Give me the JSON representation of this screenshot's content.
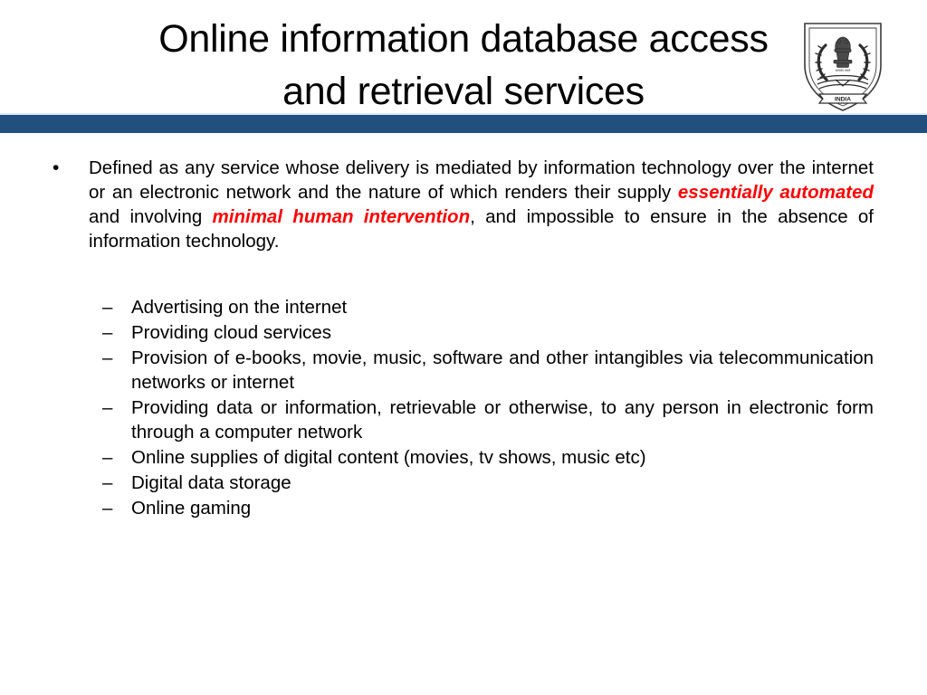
{
  "slide": {
    "background_color": "#ffffff",
    "accent_bar_color": "#21507f",
    "accent_bar_hairline_color": "#dce9f2",
    "highlight_color": "#ff0000",
    "text_color": "#000000"
  },
  "title": {
    "line1": "Online information database access",
    "line2": "and retrieval services",
    "full": "Online information database access and retrieval services"
  },
  "emblem": {
    "name": "india-shield-emblem",
    "banner_text": "INDIA",
    "motto_text": "सत्यमेव जयते"
  },
  "content": {
    "main_bullet": {
      "marker": "•",
      "segments": [
        {
          "text": "Defined as any service whose delivery is mediated by information technology over the internet or an electronic network and the nature of which renders their supply ",
          "style": "normal"
        },
        {
          "text": "essentially automated",
          "style": "highlight"
        },
        {
          "text": " and involving ",
          "style": "normal"
        },
        {
          "text": "minimal human intervention",
          "style": "highlight"
        },
        {
          "text": ", and impossible to ensure in the absence of information technology.",
          "style": "normal"
        }
      ],
      "plain_text": "Defined as any service whose delivery is mediated by information technology over the internet or an electronic network and the nature of which renders their supply essentially automated and involving minimal human intervention, and impossible to ensure in the absence of information technology."
    },
    "sub_bullets": {
      "marker": "–",
      "items": [
        "Advertising on the internet",
        "Providing cloud services",
        "Provision of e-books, movie, music, software and other intangibles via telecommunication networks or internet",
        "Providing data or information, retrievable or otherwise, to any person in electronic form through a computer network",
        "Online supplies of digital content (movies, tv shows, music etc)",
        "Digital data storage",
        "Online gaming"
      ]
    }
  }
}
